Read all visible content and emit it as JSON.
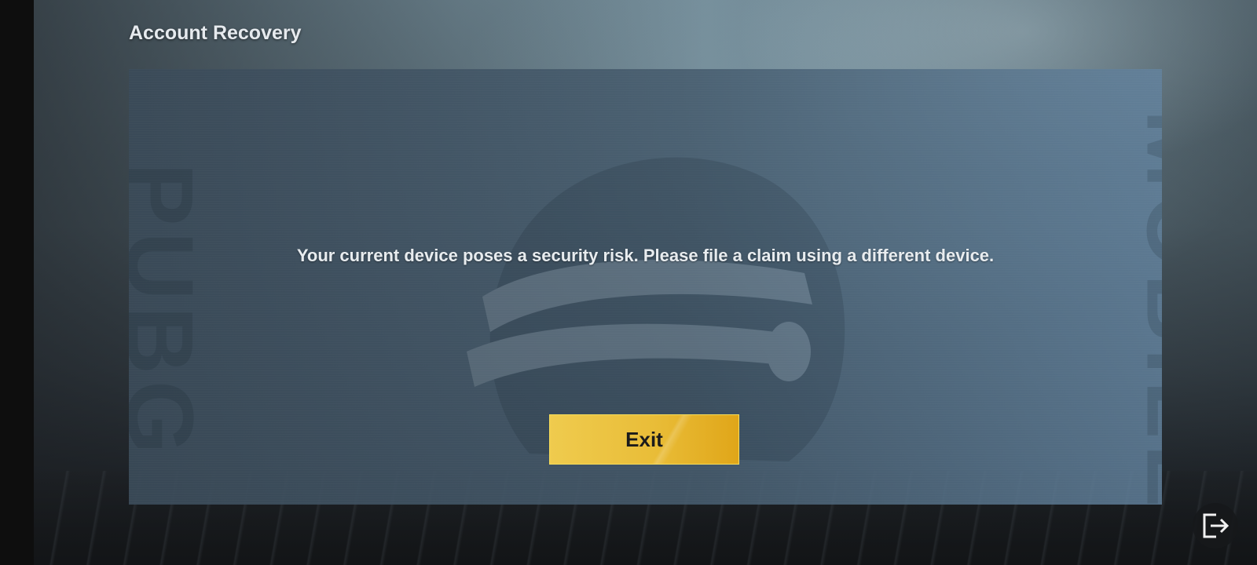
{
  "window": {
    "title": "Account Recovery"
  },
  "dialog": {
    "message": "Your current device poses a security risk. Please file a claim using a different device.",
    "exit_label": "Exit"
  },
  "icons": {
    "logout": "logout-icon",
    "background_emblem": "helmet-emblem"
  },
  "colors": {
    "button_gold": "#e9bd38",
    "panel": "#465c6e"
  }
}
